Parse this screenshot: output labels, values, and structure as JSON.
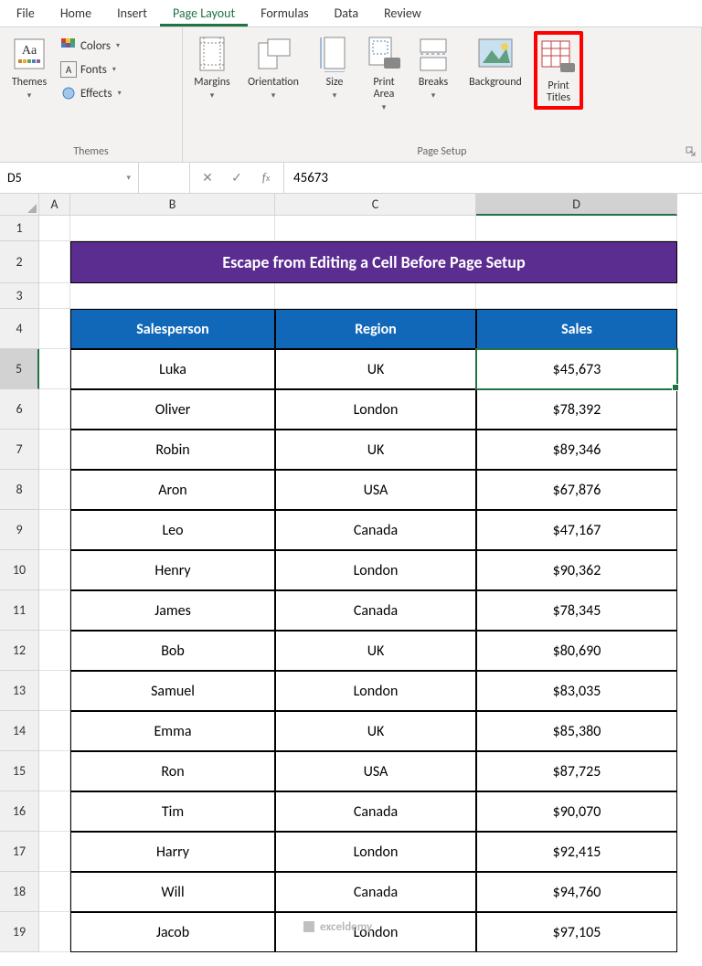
{
  "tabs": [
    "File",
    "Home",
    "Insert",
    "Page Layout",
    "Formulas",
    "Data",
    "Review"
  ],
  "active_tab": 3,
  "themes": {
    "label": "Themes",
    "btn": "Themes",
    "colors": "Colors",
    "fonts": "Fonts",
    "effects": "Effects"
  },
  "page_setup": {
    "label": "Page Setup",
    "margins": "Margins",
    "orientation": "Orientation",
    "size": "Size",
    "print_area": "Print\nArea",
    "breaks": "Breaks",
    "background": "Background",
    "print_titles": "Print\nTitles"
  },
  "name_box": "D5",
  "formula_value": "45673",
  "columns": [
    "A",
    "B",
    "C",
    "D"
  ],
  "selected_col": "D",
  "selected_row": 5,
  "row_start": 1,
  "row_end": 19,
  "title": "Escape from Editing a Cell Before Page Setup",
  "headers": [
    "Salesperson",
    "Region",
    "Sales"
  ],
  "rows": [
    [
      "Luka",
      "UK",
      "$45,673"
    ],
    [
      "Oliver",
      "London",
      "$78,392"
    ],
    [
      "Robin",
      "UK",
      "$89,346"
    ],
    [
      "Aron",
      "USA",
      "$67,876"
    ],
    [
      "Leo",
      "Canada",
      "$47,167"
    ],
    [
      "Henry",
      "London",
      "$90,362"
    ],
    [
      "James",
      "Canada",
      "$78,345"
    ],
    [
      "Bob",
      "UK",
      "$80,690"
    ],
    [
      "Samuel",
      "London",
      "$83,035"
    ],
    [
      "Emma",
      "UK",
      "$85,380"
    ],
    [
      "Ron",
      "USA",
      "$87,725"
    ],
    [
      "Tim",
      "Canada",
      "$90,070"
    ],
    [
      "Harry",
      "London",
      "$92,415"
    ],
    [
      "Will",
      "Canada",
      "$94,760"
    ],
    [
      "Jacob",
      "London",
      "$97,105"
    ]
  ],
  "watermark": "exceldemy",
  "row_heights": {
    "title": 46,
    "blank": 28,
    "header": 44,
    "data": 44
  }
}
